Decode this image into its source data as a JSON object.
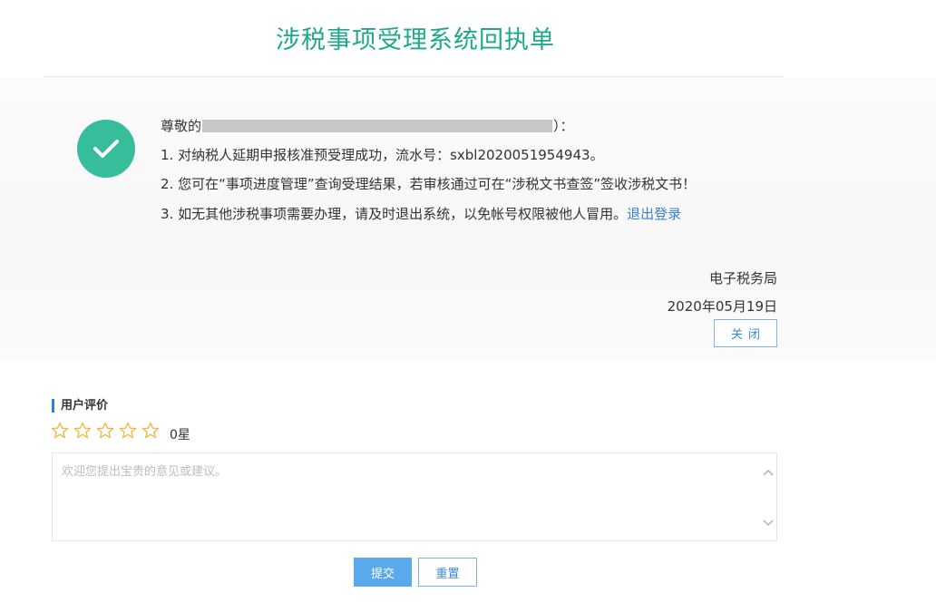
{
  "page": {
    "title": "涉税事项受理系统回执单"
  },
  "receipt": {
    "greeting_prefix": "尊敬的",
    "greeting_suffix": "）：",
    "line1": "1. 对纳税人延期申报核准预受理成功，流水号：sxbl2020051954943。",
    "line2": "2. 您可在“事项进度管理”查询受理结果，若审核通过可在“涉税文书查签”签收涉税文书！",
    "line3": "3. 如无其他涉税事项需要办理，请及时退出系统，以免帐号权限被他人冒用。",
    "logout_link": "退出登录",
    "issuer": "电子税务局",
    "date": "2020年05月19日",
    "close_label": "关闭"
  },
  "rating": {
    "title": "用户评价",
    "max_stars": 5,
    "selected_stars": 0,
    "star_count_text": "0星",
    "placeholder": "欢迎您提出宝贵的意见或建议。",
    "submit_label": "提交",
    "reset_label": "重置"
  },
  "colors": {
    "title": "#1fa88c",
    "check_badge": "#37bd9c",
    "link": "#3a7fd5",
    "primary_button": "#5aa9ec",
    "star_outline": "#f0b63c"
  }
}
